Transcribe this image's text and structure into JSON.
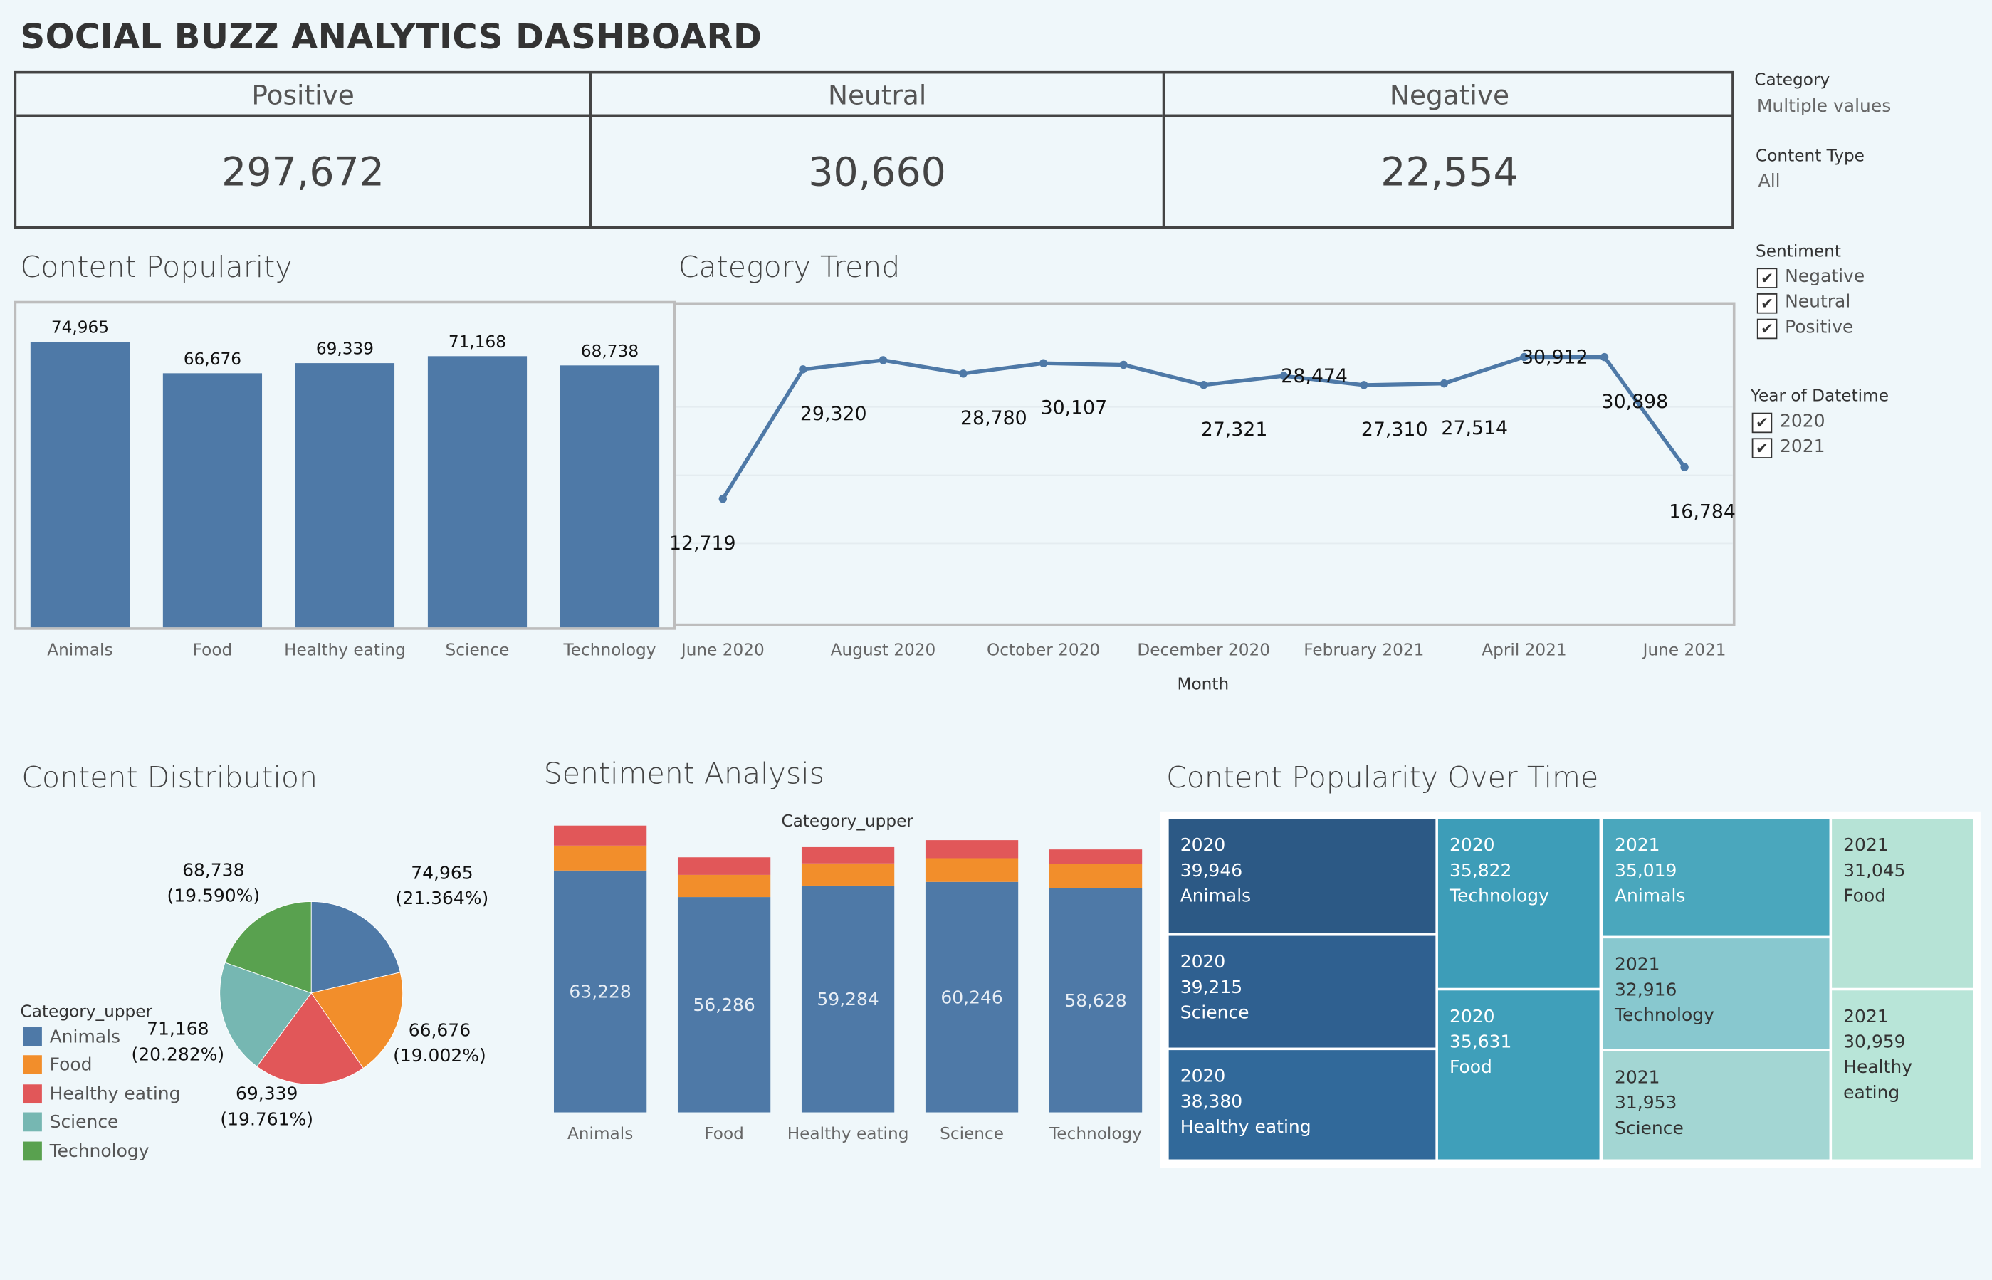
{
  "dashboard_title": "SOCIAL BUZZ ANALYTICS DASHBOARD",
  "kpis": [
    {
      "label": "Positive",
      "value": "297,672"
    },
    {
      "label": "Neutral",
      "value": "30,660"
    },
    {
      "label": "Negative",
      "value": "22,554"
    }
  ],
  "filters": {
    "category": {
      "label": "Category",
      "value": "Multiple values"
    },
    "content_type": {
      "label": "Content Type",
      "value": "All"
    },
    "sentiment": {
      "label": "Sentiment",
      "options": [
        "Negative",
        "Neutral",
        "Positive"
      ]
    },
    "year": {
      "label": "Year of Datetime",
      "options": [
        "2020",
        "2021"
      ]
    }
  },
  "sections": {
    "content_popularity": "Content Popularity",
    "category_trend": "Category Trend",
    "content_distribution": "Content Distribution",
    "sentiment_analysis": "Sentiment Analysis",
    "popularity_over_time": "Content Popularity Over Time"
  },
  "legend_title": "Category_upper",
  "colors": {
    "bar": "#4e79a7",
    "animals": "#4e79a7",
    "food": "#f28e2b",
    "healthy_eating": "#e15759",
    "science": "#76b7b2",
    "technology": "#59a14f",
    "neutral": "#f28e2b",
    "negative": "#e15759"
  },
  "chart_data": [
    {
      "id": "content_popularity",
      "type": "bar",
      "categories": [
        "Animals",
        "Food",
        "Healthy eating",
        "Science",
        "Technology"
      ],
      "values": [
        74965,
        66676,
        69339,
        71168,
        68738
      ],
      "value_labels": [
        "74,965",
        "66,676",
        "69,339",
        "71,168",
        "68,738"
      ],
      "ylim": [
        0,
        80000
      ]
    },
    {
      "id": "category_trend",
      "type": "line",
      "xlabel": "Month",
      "x": [
        "2020-06",
        "2020-07",
        "2020-08",
        "2020-09",
        "2020-10",
        "2020-11",
        "2020-12",
        "2021-01",
        "2021-02",
        "2021-03",
        "2021-04",
        "2021-05",
        "2021-06"
      ],
      "values": [
        12719,
        29320,
        30500,
        28780,
        30107,
        29900,
        27321,
        28474,
        27310,
        27514,
        30912,
        30898,
        16784
      ],
      "point_labels": [
        "12,719",
        "29,320",
        "",
        "28,780",
        "30,107",
        "",
        "27,321",
        "28,474",
        "27,310",
        "27,514",
        "30,912",
        "30,898",
        "16,784"
      ],
      "x_ticks": [
        "June 2020",
        "August 2020",
        "October 2020",
        "December 2020",
        "February 2021",
        "April 2021",
        "June 2021"
      ],
      "ylim": [
        0,
        35000
      ]
    },
    {
      "id": "content_distribution",
      "type": "pie",
      "categories": [
        "Animals",
        "Food",
        "Healthy eating",
        "Science",
        "Technology"
      ],
      "values": [
        74965,
        66676,
        69339,
        71168,
        68738
      ],
      "percent_labels": [
        "(21.364%)",
        "(19.002%)",
        "(19.761%)",
        "(20.282%)",
        "(19.590%)"
      ],
      "value_labels": [
        "74,965",
        "66,676",
        "69,339",
        "71,168",
        "68,738"
      ]
    },
    {
      "id": "sentiment_analysis",
      "type": "bar",
      "stacked": true,
      "xlabel": "Category_upper",
      "categories": [
        "Animals",
        "Food",
        "Healthy eating",
        "Science",
        "Technology"
      ],
      "series": [
        {
          "name": "Positive",
          "values": [
            63228,
            56286,
            59284,
            60246,
            58628
          ],
          "labels": [
            "63,228",
            "56,286",
            "59,284",
            "60,246",
            "58,628"
          ]
        },
        {
          "name": "Neutral",
          "values": [
            6500,
            5800,
            5800,
            6200,
            6300
          ]
        },
        {
          "name": "Negative",
          "values": [
            5237,
            4590,
            4255,
            4722,
            3810
          ]
        }
      ],
      "ylim": [
        0,
        80000
      ]
    },
    {
      "id": "popularity_over_time",
      "type": "heatmap",
      "cells": [
        {
          "year": "2020",
          "value": "39,946",
          "category": "Animals",
          "color": "#2c5985"
        },
        {
          "year": "2020",
          "value": "39,215",
          "category": "Science",
          "color": "#2f6090"
        },
        {
          "year": "2020",
          "value": "38,380",
          "category": "Healthy eating",
          "color": "#31699a"
        },
        {
          "year": "2020",
          "value": "35,822",
          "category": "Technology",
          "color": "#3d9db8"
        },
        {
          "year": "2020",
          "value": "35,631",
          "category": "Food",
          "color": "#3f9fba"
        },
        {
          "year": "2021",
          "value": "35,019",
          "category": "Animals",
          "color": "#4aa7bd"
        },
        {
          "year": "2021",
          "value": "32,916",
          "category": "Technology",
          "color": "#88c8cf"
        },
        {
          "year": "2021",
          "value": "31,953",
          "category": "Science",
          "color": "#a3d6d3"
        },
        {
          "year": "2021",
          "value": "31,045",
          "category": "Food",
          "color": "#b6e3d6"
        },
        {
          "year": "2021",
          "value": "30,959",
          "category": "Healthy eating",
          "color": "#b8e5d8"
        }
      ]
    }
  ]
}
